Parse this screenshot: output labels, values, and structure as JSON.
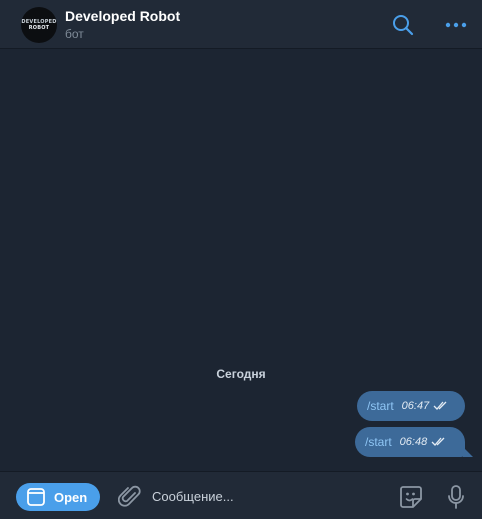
{
  "header": {
    "avatar_line1": "DEVELOPED",
    "avatar_line2": "ROBOT",
    "title": "Developed Robot",
    "subtitle": "бот",
    "search_icon": "search-icon",
    "more_icon": "more-dots-icon"
  },
  "chat": {
    "date_separator": "Сегодня",
    "messages": [
      {
        "text": "/start",
        "time": "06:47",
        "status": "read"
      },
      {
        "text": "/start",
        "time": "06:48",
        "status": "read"
      }
    ]
  },
  "composer": {
    "open_label": "Open",
    "placeholder": "Сообщение...",
    "attach_icon": "paperclip-icon",
    "sticker_icon": "sticker-icon",
    "mic_icon": "microphone-icon"
  },
  "colors": {
    "background": "#1c2532",
    "header": "#212a37",
    "accent": "#4a9fea",
    "bubble": "#3d6a99",
    "command_link": "#8ec5f4"
  }
}
